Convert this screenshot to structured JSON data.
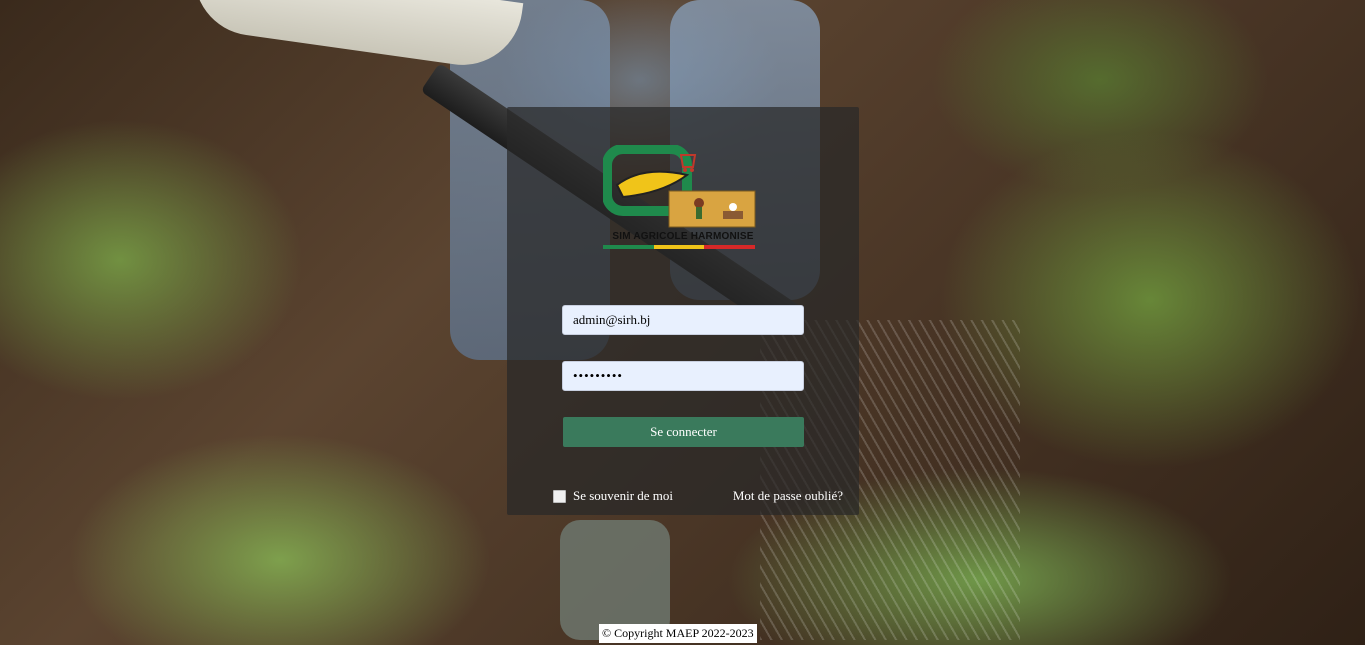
{
  "background": {
    "scene_icon": "garden-watering-photo"
  },
  "logo": {
    "text": "SIM AGRICOLE HARMONISE",
    "icon": "sim-agricole-logo-icon",
    "colors": {
      "green": "#1f8a4c",
      "yellow": "#f0c419",
      "red": "#d62828"
    }
  },
  "form": {
    "email_value": "admin@sirh.bj",
    "password_value": "•••••••••",
    "submit_label": "Se connecter",
    "remember_label": "Se souvenir de moi",
    "remember_checked": false,
    "forgot_label": "Mot de passe oublié?"
  },
  "colors": {
    "button": "#3a7a5c",
    "panel": "rgba(40,40,40,0.72)",
    "input_bg": "#e8f0fe"
  },
  "footer": {
    "copyright": "© Copyright MAEP 2022-2023"
  }
}
